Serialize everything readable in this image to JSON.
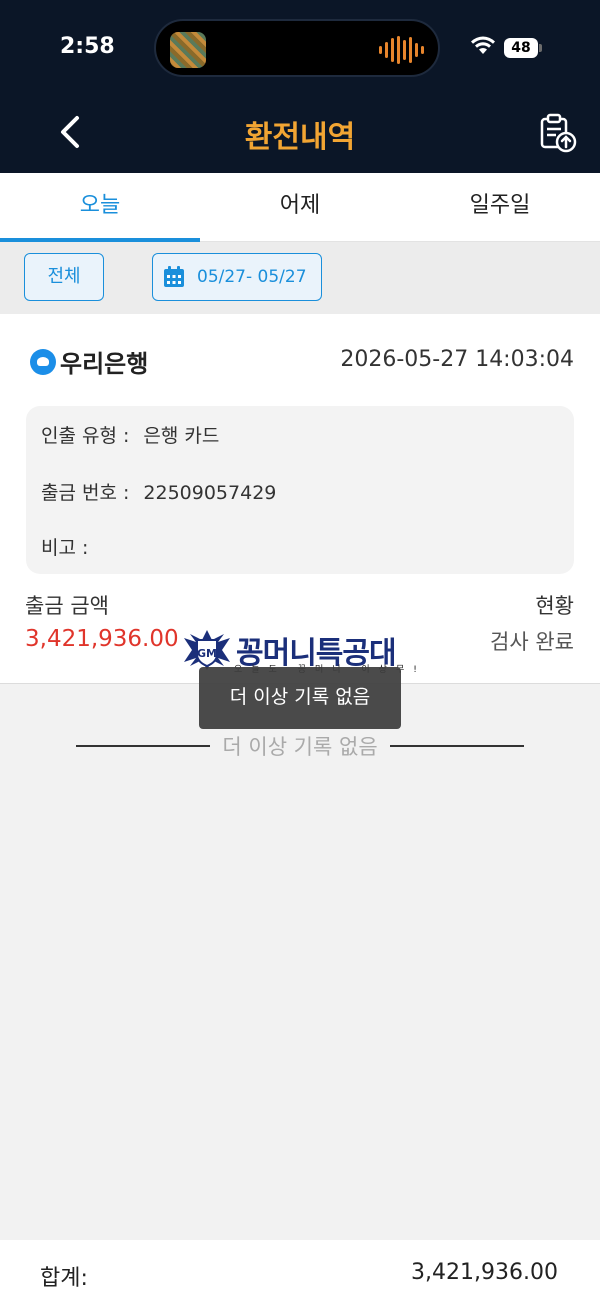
{
  "status_bar": {
    "time": "2:58",
    "battery": "48"
  },
  "header": {
    "title": "환전내역"
  },
  "tabs": [
    {
      "label": "오늘",
      "active": true
    },
    {
      "label": "어제",
      "active": false
    },
    {
      "label": "일주일",
      "active": false
    }
  ],
  "filter": {
    "all_label": "전체",
    "date_range": "05/27- 05/27"
  },
  "record": {
    "bank_name": "우리은행",
    "datetime": "2026-05-27 14:03:04",
    "withdraw_type_label": "인출 유형 :",
    "withdraw_type_value": "은행 카드",
    "number_label": "출금 번호 :",
    "number_value": "22509057429",
    "note_label": "비고 :",
    "note_value": "",
    "amount_label": "출금 금액",
    "amount_value": "3,421,936.00",
    "status_label": "현황",
    "status_value": "검사 완료"
  },
  "watermark": {
    "text": "꽁머니특공대",
    "subtext": "오늘도 꽁머니 이상무!"
  },
  "toast": {
    "text": "더 이상 기록 없음"
  },
  "end_of_list": {
    "text": "더 이상 기록 없음"
  },
  "footer": {
    "total_label": "합계:",
    "total_value": "3,421,936.00"
  },
  "colors": {
    "header_bg": "#0b1627",
    "title": "#f2a533",
    "accent": "#1a8fdb",
    "amount": "#e0352b"
  },
  "icons": {
    "back": "chevron-left-icon",
    "export": "clipboard-upload-icon",
    "calendar": "calendar-icon",
    "bank": "woori-bank-logo"
  }
}
